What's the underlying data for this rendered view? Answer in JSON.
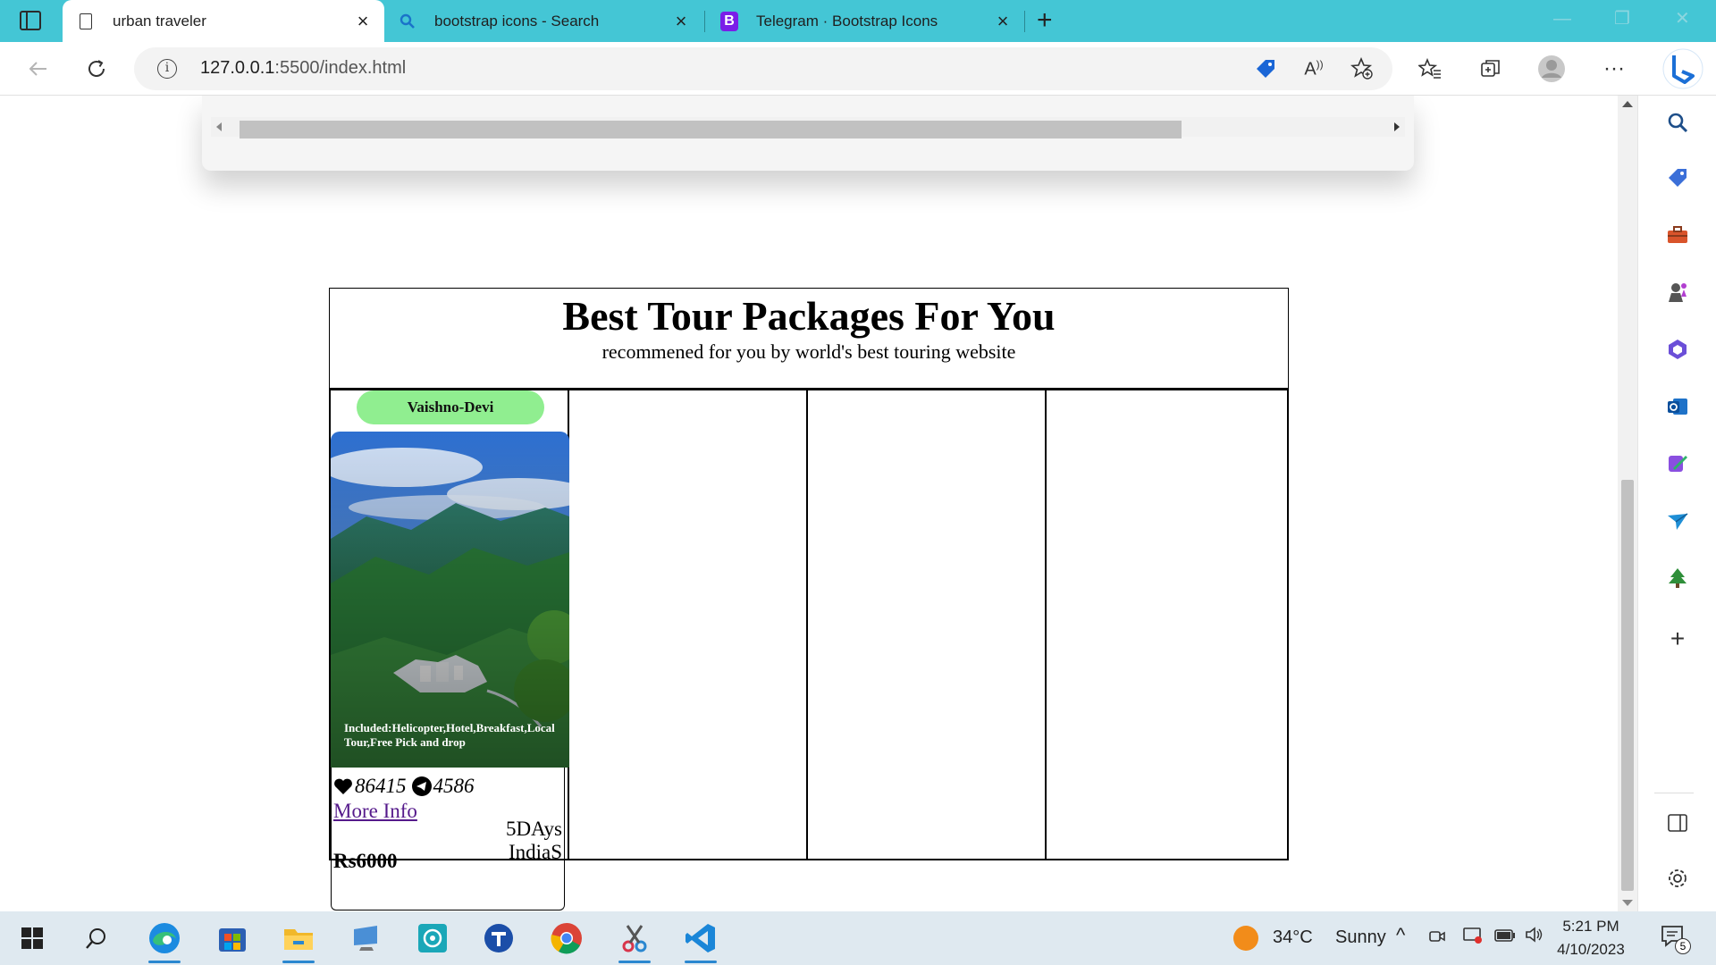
{
  "browser": {
    "tabs": [
      {
        "label": "urban traveler",
        "active": true,
        "icon": "document-icon"
      },
      {
        "label": "bootstrap icons - Search",
        "active": false,
        "icon": "search-icon"
      },
      {
        "label": "Telegram · Bootstrap Icons",
        "active": false,
        "icon": "bootstrap-icon"
      }
    ],
    "bootstrap_icon_letter": "B",
    "url_host": "127.0.0.1",
    "url_path": ":5500/index.html"
  },
  "page": {
    "section_title": "Best Tour Packages For You",
    "section_subtitle": "recommened for you by world's best touring website",
    "package": {
      "badge": "Vaishno-Devi",
      "included": "Included:Helicopter,Hotel,Breakfast,Local Tour,Free Pick and drop",
      "likes": "86415",
      "shares": "4586",
      "more_info": "More Info",
      "days": "5DAys",
      "country": "IndiaS",
      "price": "Rs6000"
    }
  },
  "taskbar": {
    "weather_temp": "34°C",
    "weather_desc": "Sunny",
    "time": "5:21 PM",
    "date": "4/10/2023",
    "notification_count": "5"
  },
  "colors": {
    "tabstrip": "#44c6d5",
    "badge": "#90ee90",
    "link": "#551a8b",
    "taskbar": "#dfe9f0"
  }
}
